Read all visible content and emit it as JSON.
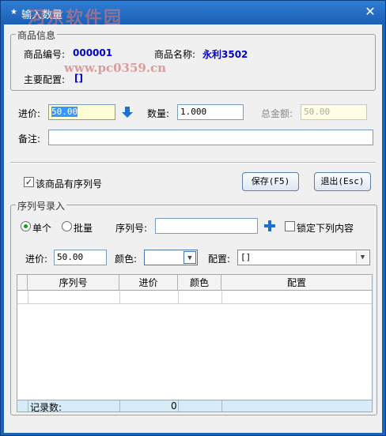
{
  "window": {
    "title": "输入数量",
    "watermark_text": "河东软件园",
    "watermark_url": "www.pc0359.cn",
    "close_glyph": "✕"
  },
  "product_info": {
    "group_title": "商品信息",
    "code_label": "商品编号:",
    "code_value": "000001",
    "name_label": "商品名称:",
    "name_value": "永利3502",
    "config_label": "主要配置:",
    "config_value": "[]"
  },
  "entry": {
    "price_label": "进价:",
    "price_value": "50.00",
    "qty_label": "数量:",
    "qty_value": "1.000",
    "total_label": "总金额:",
    "total_value": "50.00",
    "note_label": "备注:",
    "note_value": ""
  },
  "actions": {
    "has_serial_label": "该商品有序列号",
    "has_serial_checked": true,
    "save_label": "保存(F5)",
    "exit_label": "退出(Esc)"
  },
  "serial_entry": {
    "group_title": "序列号录入",
    "mode_single_label": "单个",
    "mode_batch_label": "批量",
    "mode_selected": "单个",
    "serial_label": "序列号:",
    "serial_value": "",
    "lock_label": "锁定下列内容",
    "lock_checked": false,
    "price_label": "进价:",
    "price_value": "50.00",
    "color_label": "颜色:",
    "color_value": "",
    "config_label": "配置:",
    "config_value": "[]"
  },
  "grid": {
    "columns": [
      "",
      "序列号",
      "进价",
      "颜色",
      "配置"
    ],
    "footer_label": "记录数:",
    "footer_count": "0"
  },
  "colors": {
    "title_bar": "#1a5fb3",
    "accent_blue": "#0000cc",
    "icon_blue": "#1e6fd0",
    "footer_bg": "#d8ecf7"
  }
}
